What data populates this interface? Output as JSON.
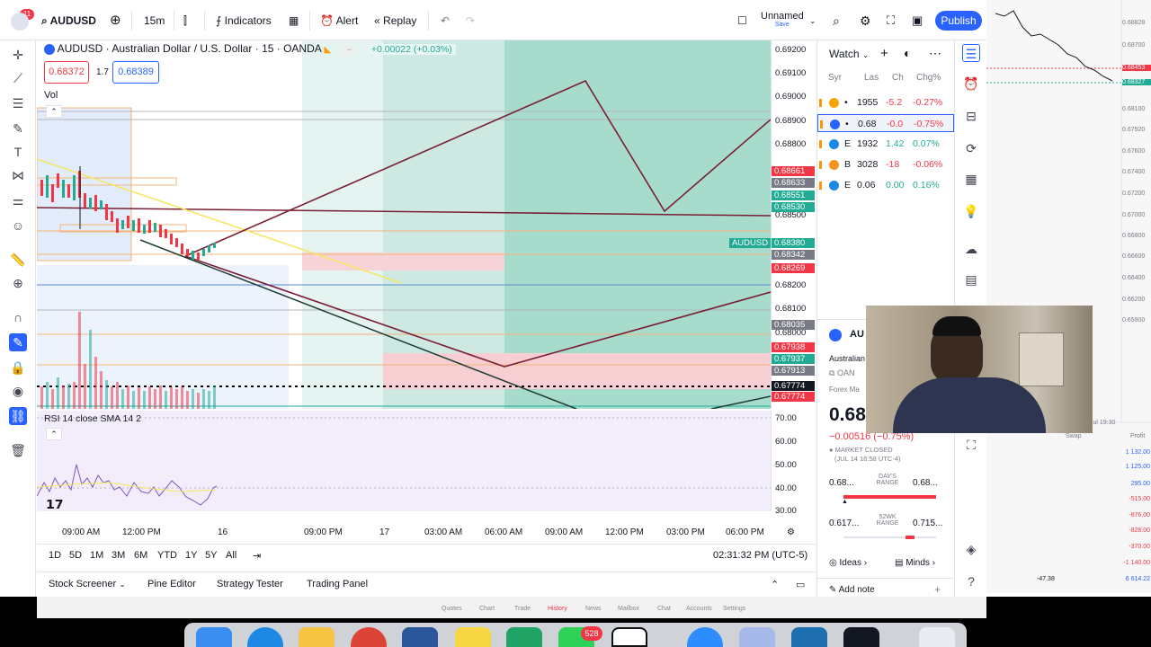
{
  "topbar": {
    "notif_count": "11",
    "symbol": "AUDUSD",
    "interval": "15m",
    "indicators": "Indicators",
    "alert": "Alert",
    "replay": "Replay",
    "layout_name": "Unnamed",
    "layout_status": "Save",
    "publish": "Publish"
  },
  "legend": {
    "title": "AUDUSD · Australian Dollar / U.S. Dollar · 15 · OANDA",
    "change": "+0.00022 (+0.03%)",
    "sell": "0.68372",
    "spread": "1.7",
    "buy": "0.68389",
    "vol": "Vol"
  },
  "price_labels": [
    "0.69200",
    "0.69100",
    "0.69000",
    "0.68900",
    "0.68800",
    "0.68500",
    "0.68200",
    "0.68100",
    "0.68000",
    "0.67900",
    "0.67800"
  ],
  "price_tags": [
    {
      "text": "0.68661",
      "color": "#f23645"
    },
    {
      "text": "0.68633",
      "color": "#787b86"
    },
    {
      "text": "0.68551",
      "color": "#22ab94"
    },
    {
      "text": "0.68530",
      "color": "#22ab94"
    },
    {
      "text": "0.68380",
      "color": "#22ab94"
    },
    {
      "text": "0.68342",
      "color": "#787b86"
    },
    {
      "text": "0.68269",
      "color": "#f23645"
    },
    {
      "text": "0.68035",
      "color": "#787b86"
    },
    {
      "text": "0.67938",
      "color": "#f23645"
    },
    {
      "text": "0.67937",
      "color": "#22ab94"
    },
    {
      "text": "0.67913",
      "color": "#787b86"
    },
    {
      "text": "0.67774",
      "color": "#131722"
    },
    {
      "text": "0.67774",
      "color": "#f23645"
    }
  ],
  "symbol_tag": "AUDUSD",
  "rsi": {
    "label": "RSI 14 close SMA 14 2",
    "levels": [
      "70.00",
      "60.00",
      "50.00",
      "40.00",
      "30.00"
    ]
  },
  "time_labels": [
    "09:00 AM",
    "12:00 PM",
    "16",
    "09:00 PM",
    "17",
    "03:00 AM",
    "06:00 AM",
    "09:00 AM",
    "12:00 PM",
    "03:00 PM",
    "06:00 PM"
  ],
  "ranges": [
    "1D",
    "5D",
    "1M",
    "3M",
    "6M",
    "YTD",
    "1Y",
    "5Y",
    "All"
  ],
  "clock": "02:31:32 PM (UTC-5)",
  "bottom_tabs": [
    "Stock Screener",
    "Pine Editor",
    "Strategy Tester",
    "Trading Panel"
  ],
  "watchlist": {
    "title": "Watch",
    "headers": [
      "Syr",
      "Las",
      "Ch",
      "Chg%"
    ],
    "rows": [
      {
        "sym": "",
        "last": "1955",
        "chg": "-5.2",
        "pct": "-0.27%",
        "color": "#f23645",
        "icon": "#f7a600"
      },
      {
        "sym": "",
        "last": "0.68",
        "chg": "-0.0",
        "pct": "-0.75%",
        "color": "#f23645",
        "icon": "#2962ff"
      },
      {
        "sym": "E",
        "last": "1932",
        "chg": "1.42",
        "pct": "0.07%",
        "color": "#22ab94",
        "icon": "#1e88e5"
      },
      {
        "sym": "B",
        "last": "3028",
        "chg": "-18",
        "pct": "-0.06%",
        "color": "#f23645",
        "icon": "#f7931a"
      },
      {
        "sym": "E",
        "last": "0.06",
        "chg": "0.00",
        "pct": "0.16%",
        "color": "#22ab94",
        "icon": "#1e88e5"
      }
    ]
  },
  "details": {
    "symbol": "AU",
    "name": "Australian",
    "exchange": "OAN",
    "category": "Forex Ma",
    "price": "0.68",
    "change": "−0.00516 (−0.75%)",
    "status": "MARKET CLOSED",
    "status_time": "(JUL 14 16:58 UTC-4)",
    "day_low": "0.68...",
    "day_high": "0.68...",
    "day_range": "DAY'S RANGE",
    "wk_low": "0.617...",
    "wk_high": "0.715...",
    "wk_range": "52WK RANGE",
    "ideas": "Ideas",
    "minds": "Minds",
    "add_note": "Add note"
  },
  "bg_window": {
    "prices": [
      "0.68828",
      "0.68700",
      "0.68453",
      "0.68327",
      "0.68100",
      "0.67920",
      "0.67600",
      "0.67400",
      "0.67200",
      "0.67000",
      "0.66800",
      "0.66600",
      "0.66400",
      "0.66200",
      "0.65900"
    ],
    "bottom_vals": [
      "1 132.00",
      "1 125.00",
      "295.00",
      "-515.00",
      "-876.00",
      "-828.00",
      "-370.00",
      "-1 140.00",
      "6 614.22"
    ],
    "net": "-47.38",
    "time_label": "Jul 19:30",
    "swap": "Swap",
    "profit": "Profit"
  },
  "dock_badge": "528",
  "overlay_tabs": [
    "Quotes",
    "Chart",
    "Trade",
    "History",
    "News",
    "Mailbox",
    "Chat",
    "Accounts",
    "Settings"
  ]
}
